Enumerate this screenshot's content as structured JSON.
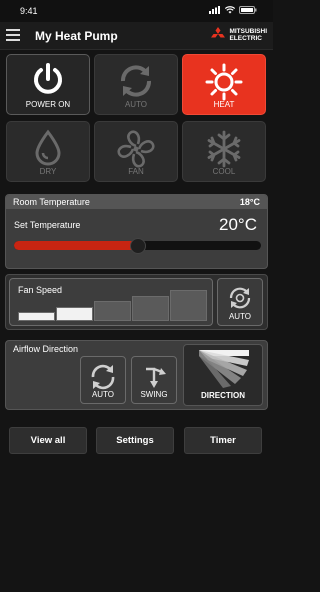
{
  "status_bar": {
    "time": "9:41"
  },
  "header": {
    "title": "My Heat Pump",
    "brand_line1": "MITSUBISHI",
    "brand_line2": "ELECTRIC"
  },
  "modes": [
    {
      "label": "POWER ON",
      "icon": "power-icon",
      "state": "on"
    },
    {
      "label": "AUTO",
      "icon": "auto-cycle-icon",
      "state": "off"
    },
    {
      "label": "HEAT",
      "icon": "sun-icon",
      "state": "selected"
    },
    {
      "label": "DRY",
      "icon": "droplet-icon",
      "state": "off"
    },
    {
      "label": "FAN",
      "icon": "fan-icon",
      "state": "off"
    },
    {
      "label": "COOL",
      "icon": "snowflake-icon",
      "state": "off"
    }
  ],
  "temperature": {
    "room_label": "Room Temperature",
    "room_value": "18°C",
    "set_label": "Set Temperature",
    "set_value": "20°C",
    "slider_fraction": 0.5
  },
  "fan_speed": {
    "title": "Fan Speed",
    "levels": 5,
    "active_levels": 2,
    "auto_label": "AUTO"
  },
  "airflow": {
    "title": "Airflow Direction",
    "auto_label": "AUTO",
    "swing_label": "SWING",
    "direction_label": "DIRECTION"
  },
  "bottom_buttons": {
    "view_all": "View all",
    "settings": "Settings",
    "timer": "Timer"
  },
  "colors": {
    "accent": "#e8331f",
    "slider": "#c82512"
  }
}
